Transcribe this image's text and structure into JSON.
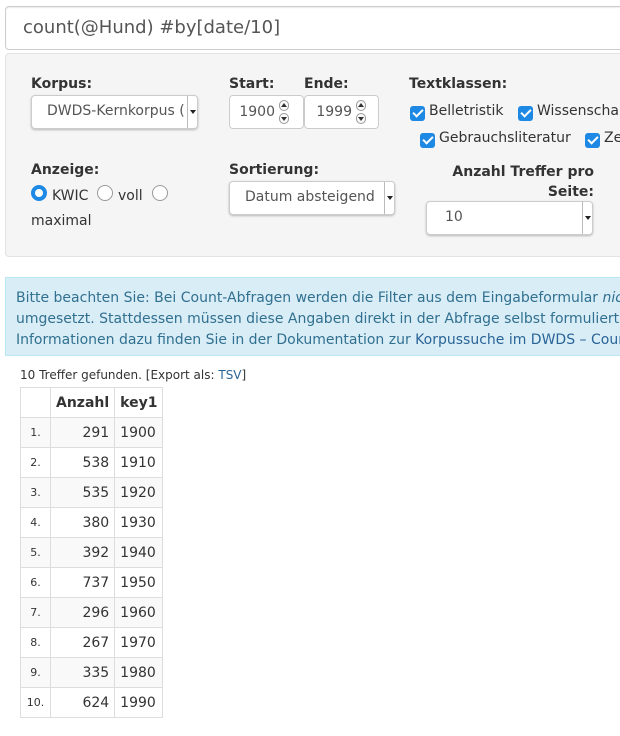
{
  "query": "count(@Hund) #by[date/10]",
  "filters": {
    "corpus_label": "Korpus:",
    "corpus_value": "DWDS-Kernkorpus (",
    "start_label": "Start:",
    "start_value": "1900",
    "end_label": "Ende:",
    "end_value": "1999",
    "textclasses_label": "Textklassen:",
    "textclasses": [
      "Belletristik",
      "Wissenscha",
      "Gebrauchsliteratur",
      "Ze"
    ],
    "display_label": "Anzeige:",
    "display_options": [
      "KWIC",
      "voll",
      "maximal"
    ],
    "sort_label": "Sortierung:",
    "sort_value": "Datum absteigend",
    "perpage_label_line1": "Anzahl Treffer pro",
    "perpage_label_line2": "Seite:",
    "perpage_value": "10"
  },
  "alert": {
    "line1_a": "Bitte beachten Sie: Bei Count-Abfragen werden die Filter aus dem Eingabeformular ",
    "line1_em": "nic",
    "line2": "umgesetzt. Stattdessen müssen diese Angaben direkt in der Abfrage selbst formuliert",
    "line3_a": "Informationen dazu finden Sie in der Dokumentation zur ",
    "line3_link": "Korpussuche im DWDS – Count-"
  },
  "results": {
    "summary": "10 Treffer gefunden. [Export als: ",
    "export_link": "TSV",
    "summary_end": "]",
    "columns": [
      "",
      "Anzahl",
      "key1"
    ],
    "rows": [
      [
        "1.",
        "291",
        "1900"
      ],
      [
        "2.",
        "538",
        "1910"
      ],
      [
        "3.",
        "535",
        "1920"
      ],
      [
        "4.",
        "380",
        "1930"
      ],
      [
        "5.",
        "392",
        "1940"
      ],
      [
        "6.",
        "737",
        "1950"
      ],
      [
        "7.",
        "296",
        "1960"
      ],
      [
        "8.",
        "267",
        "1970"
      ],
      [
        "9.",
        "335",
        "1980"
      ],
      [
        "10.",
        "624",
        "1990"
      ]
    ]
  },
  "colors": {
    "accent": "#1e88e5",
    "alert_bg": "#d9edf7",
    "alert_text": "#31708f",
    "link": "#2a6496"
  }
}
